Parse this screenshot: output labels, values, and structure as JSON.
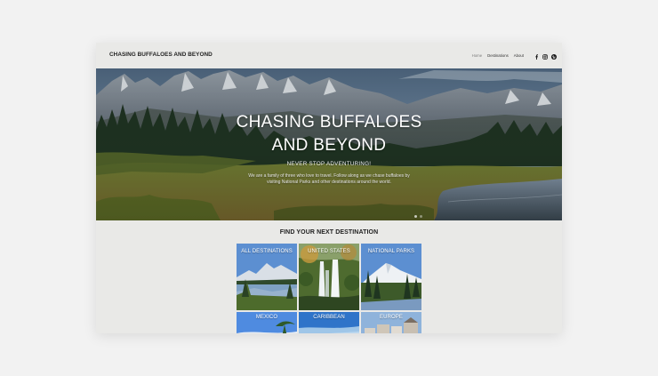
{
  "header": {
    "site_title": "CHASING BUFFALOES AND BEYOND",
    "nav": [
      {
        "label": "Home",
        "active": true
      },
      {
        "label": "Destinations",
        "active": false
      },
      {
        "label": "About",
        "active": false
      }
    ],
    "social_icons": [
      "facebook-icon",
      "instagram-icon",
      "pinterest-icon"
    ]
  },
  "hero": {
    "title_line1": "CHASING BUFFALOES",
    "title_line2": "AND BEYOND",
    "subtitle": "NEVER STOP ADVENTURING!",
    "description_line1": "We are a family of three who love to travel. Follow along as we chase buffaloes by",
    "description_line2": "visiting National Parks and other destinations around the world."
  },
  "destinations": {
    "heading": "FIND YOUR NEXT DESTINATION",
    "tiles": [
      {
        "label": "ALL DESTINATIONS"
      },
      {
        "label": "UNITED STATES"
      },
      {
        "label": "NATIONAL PARKS"
      },
      {
        "label": "MEXICO"
      },
      {
        "label": "CARIBBEAN"
      },
      {
        "label": "EUROPE"
      }
    ]
  },
  "colors": {
    "page_background": "#f2f2f2",
    "site_background": "#e9e9e7",
    "tile_sky": "#5c8fd1",
    "text_dark": "#222222"
  }
}
